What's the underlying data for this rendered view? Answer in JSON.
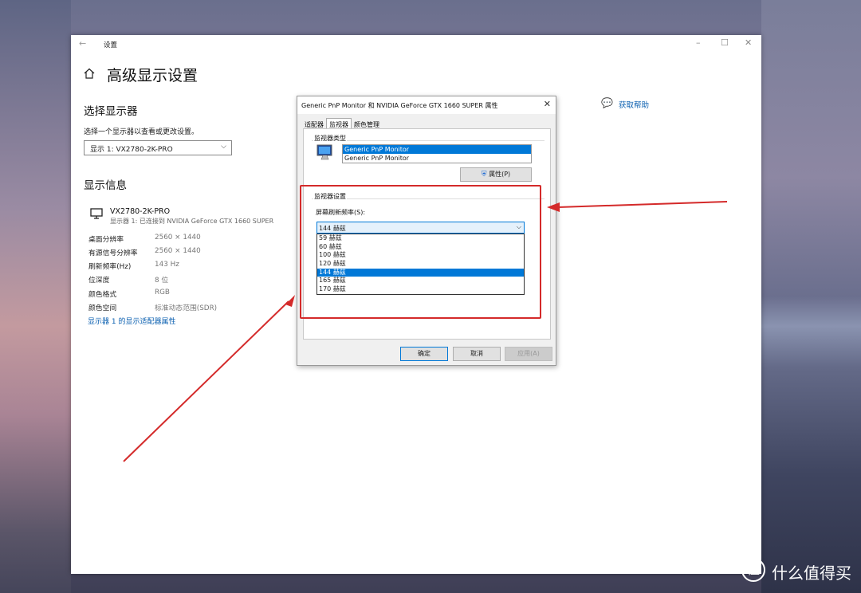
{
  "window": {
    "title": "设置",
    "page_title": "高级显示设置",
    "help_link": "获取帮助"
  },
  "select_display": {
    "heading": "选择显示器",
    "description": "选择一个显示器以查看或更改设置。",
    "selected": "显示 1: VX2780-2K-PRO"
  },
  "display_info": {
    "heading": "显示信息",
    "monitor_name": "VX2780-2K-PRO",
    "monitor_sub": "显示器 1: 已连接到 NVIDIA GeForce GTX 1660 SUPER",
    "rows": [
      {
        "label": "桌面分辨率",
        "value": "2560 × 1440"
      },
      {
        "label": "有源信号分辨率",
        "value": "2560 × 1440"
      },
      {
        "label": "刷新频率(Hz)",
        "value": "143 Hz"
      },
      {
        "label": "位深度",
        "value": "8 位"
      },
      {
        "label": "颜色格式",
        "value": "RGB"
      },
      {
        "label": "颜色空间",
        "value": "标准动态范围(SDR)"
      }
    ],
    "adapter_link": "显示器 1 的显示适配器属性"
  },
  "dialog": {
    "title": "Generic PnP Monitor 和 NVIDIA GeForce GTX 1660 SUPER 属性",
    "tabs": [
      "适配器",
      "监视器",
      "颜色管理"
    ],
    "monitor_type_label": "监视器类型",
    "monitor_list": [
      "Generic PnP Monitor",
      "Generic PnP Monitor"
    ],
    "properties_button": "属性(P)",
    "monitor_settings_label": "监视器设置",
    "refresh_label": "屏幕刷新频率(S):",
    "refresh_selected": "144 赫兹",
    "refresh_options": [
      "59 赫兹",
      "60 赫兹",
      "100 赫兹",
      "120 赫兹",
      "144 赫兹",
      "165 赫兹",
      "170 赫兹"
    ],
    "refresh_highlighted_index": 4,
    "ok": "确定",
    "cancel": "取消",
    "apply": "应用(A)"
  },
  "watermark": "什么值得买",
  "colors": {
    "accent": "#0078d7",
    "link": "#0a5fb0",
    "annotation": "#d42a2a"
  }
}
